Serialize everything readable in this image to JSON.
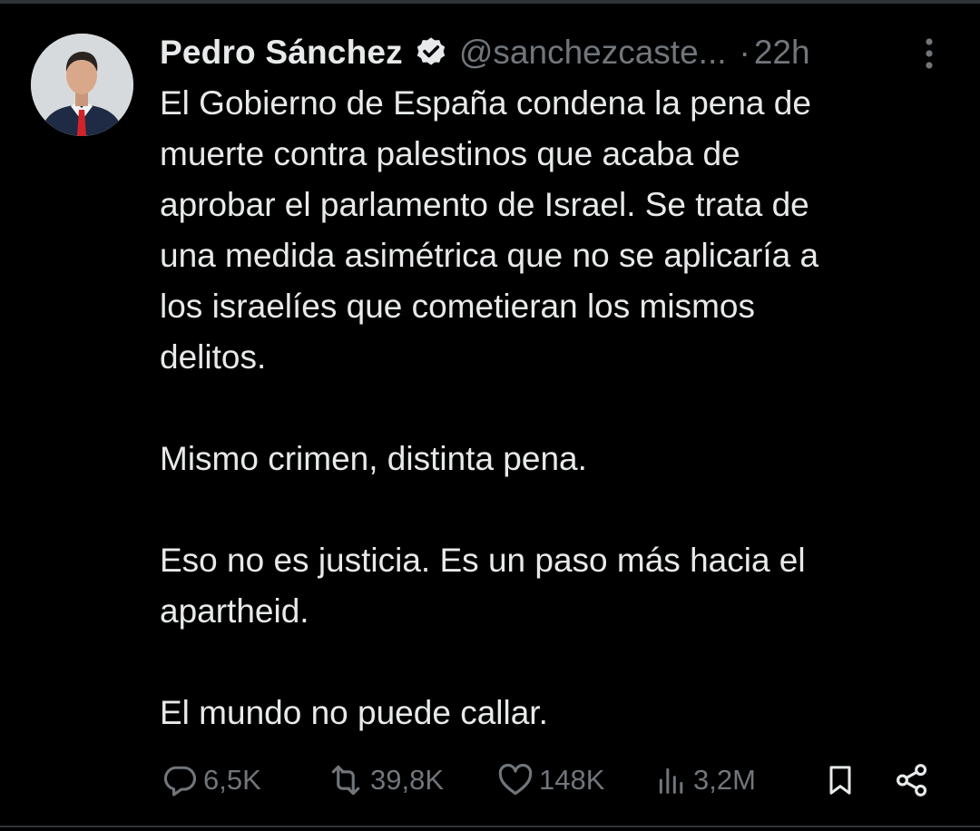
{
  "author": {
    "name": "Pedro Sánchez",
    "handle": "@sanchezcaste...",
    "verified": true,
    "separator": "·",
    "time": "22h"
  },
  "tweet": {
    "paragraphs": [
      [
        "El Gobierno de España condena la pena de",
        "muerte contra palestinos que acaba de",
        "aprobar el parlamento de Israel. Se trata de",
        "una medida asimétrica que no se aplicaría a",
        "los israelíes que cometieran los mismos",
        "delitos."
      ],
      [
        "Mismo crimen, distinta pena."
      ],
      [
        "Eso no es justicia. Es un paso más hacia el",
        "apartheid."
      ],
      [
        "El mundo no puede callar."
      ]
    ]
  },
  "actions": {
    "replies": "6,5K",
    "reposts": "39,8K",
    "likes": "148K",
    "views": "3,2M"
  },
  "icons": {
    "verified": "verified-badge-icon",
    "more": "more-vertical-icon",
    "reply": "reply-icon",
    "repost": "repost-icon",
    "like": "heart-icon",
    "views": "analytics-icon",
    "bookmark": "bookmark-icon",
    "share": "share-icon"
  },
  "colors": {
    "background": "#000000",
    "text": "#e7e9ea",
    "muted": "#71767b",
    "divider": "#2f3336",
    "tie": "#d2232a"
  }
}
